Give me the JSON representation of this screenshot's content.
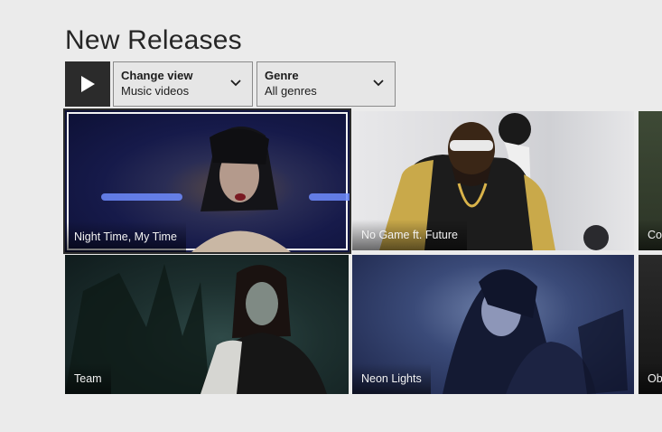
{
  "page": {
    "title": "New Releases"
  },
  "toolbar": {
    "play_icon": "play-icon",
    "change_view": {
      "label": "Change view",
      "value": "Music videos",
      "icon": "chevron-down-icon"
    },
    "genre": {
      "label": "Genre",
      "value": "All genres",
      "icon": "chevron-down-icon"
    }
  },
  "videos": [
    {
      "title": "Night Time, My Time",
      "selected": true
    },
    {
      "title": "No Game ft. Future"
    },
    {
      "title": "Cou"
    },
    {
      "title": "Team"
    },
    {
      "title": "Neon Lights"
    },
    {
      "title": "Obl"
    }
  ],
  "colors": {
    "background": "#ebebeb",
    "play_button": "#2b2b2b",
    "caption_text": "#f2f2f2"
  }
}
